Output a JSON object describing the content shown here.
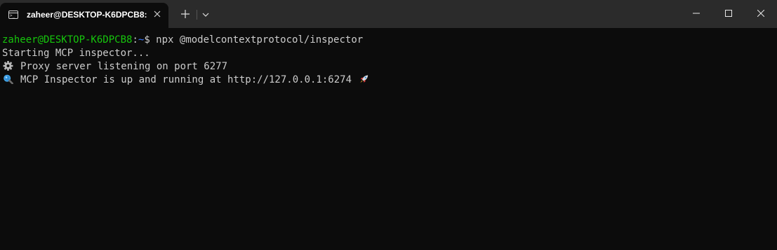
{
  "window": {
    "tab_title": "zaheer@DESKTOP-K6DPCB8:",
    "new_tab_label": "+",
    "icons": {
      "tab": "terminal-icon",
      "close": "close-icon",
      "new_tab": "plus-icon",
      "dropdown": "chevron-down-icon",
      "minimize": "minimize-icon",
      "maximize": "maximize-icon",
      "window_close": "close-icon"
    }
  },
  "terminal": {
    "prompt": {
      "user_host": "zaheer@DESKTOP-K6DPCB8",
      "separator": ":",
      "path": "~",
      "symbol": "$",
      "command": " npx @modelcontextprotocol/inspector"
    },
    "output": [
      {
        "text": "Starting MCP inspector..."
      },
      {
        "icon": "gear-icon",
        "text": "Proxy server listening on port 6277"
      },
      {
        "icon": "magnifier-icon",
        "text": "MCP Inspector is up and running at http://127.0.0.1:6274",
        "trailing_icon": "rocket-icon"
      }
    ]
  },
  "colors": {
    "background": "#0c0c0c",
    "titlebar": "#2b2b2b",
    "text": "#cccccc",
    "user_host": "#16c60c",
    "path": "#3b78ff"
  }
}
